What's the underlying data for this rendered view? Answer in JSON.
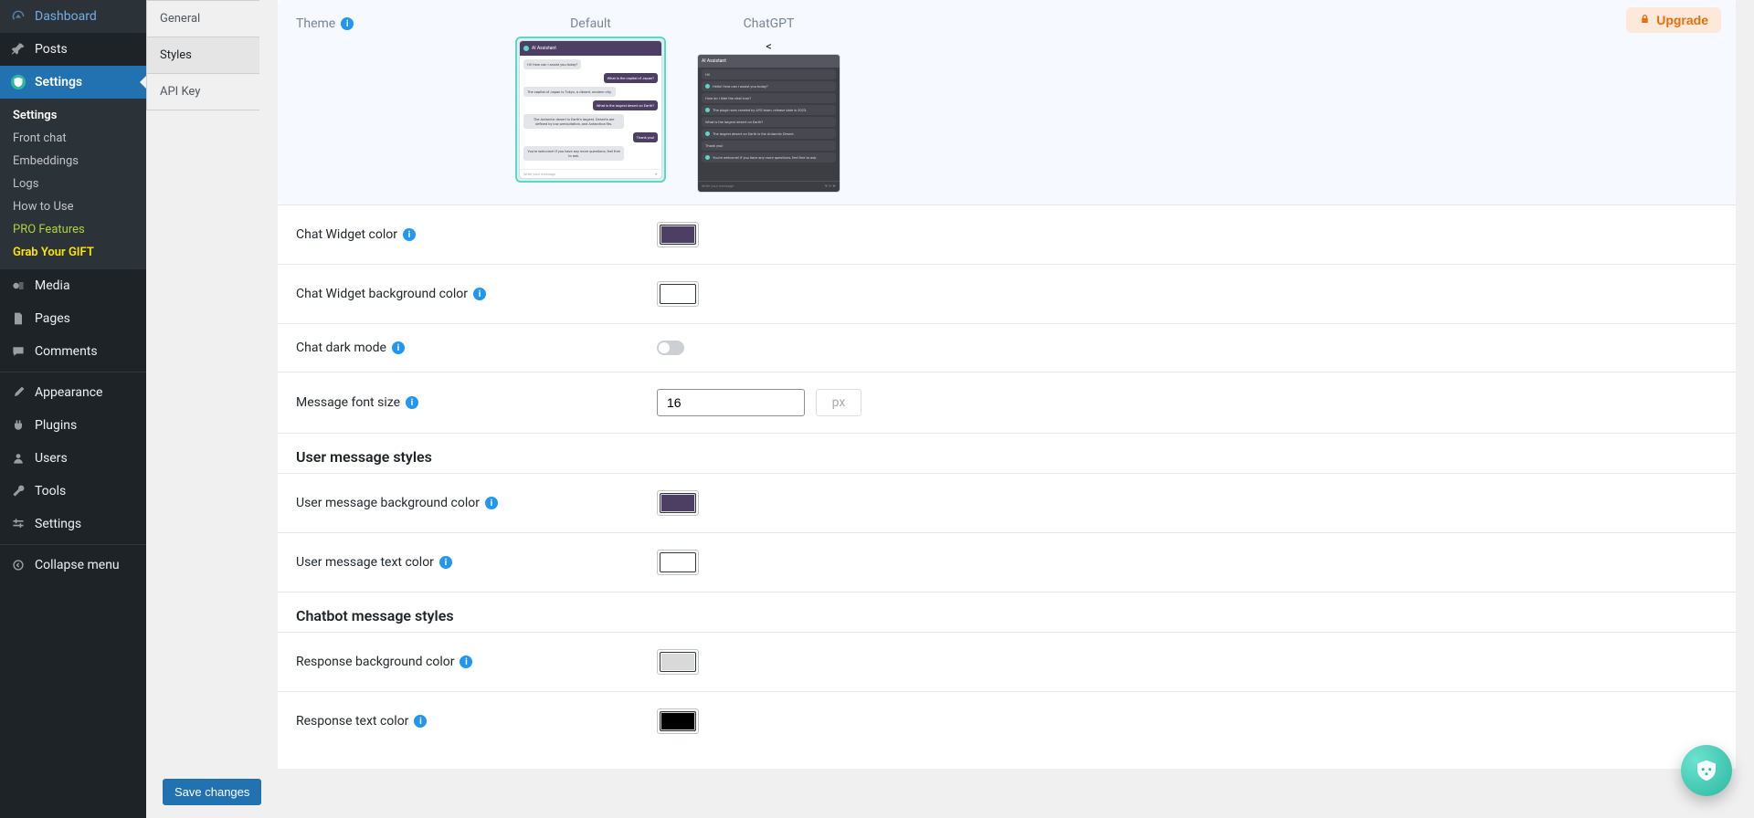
{
  "sidebar": {
    "items": [
      {
        "label": "Dashboard",
        "icon": "dash"
      },
      {
        "label": "Posts",
        "icon": "pin"
      },
      {
        "label": "Settings",
        "icon": "ai",
        "active": true
      },
      {
        "label": "Media",
        "icon": "media"
      },
      {
        "label": "Pages",
        "icon": "page"
      },
      {
        "label": "Comments",
        "icon": "comment"
      },
      {
        "label": "Appearance",
        "icon": "brush"
      },
      {
        "label": "Plugins",
        "icon": "plug"
      },
      {
        "label": "Users",
        "icon": "user"
      },
      {
        "label": "Tools",
        "icon": "wrench"
      },
      {
        "label": "Settings",
        "icon": "sliders"
      },
      {
        "label": "Collapse menu",
        "icon": "collapse"
      }
    ],
    "submenu": [
      {
        "label": "Settings",
        "current": true
      },
      {
        "label": "Front chat"
      },
      {
        "label": "Embeddings"
      },
      {
        "label": "Logs"
      },
      {
        "label": "How to Use"
      },
      {
        "label": "PRO Features",
        "pro": true
      },
      {
        "label": "Grab Your GIFT",
        "gift": true
      }
    ]
  },
  "tabs": [
    "General",
    "Styles",
    "API Key"
  ],
  "tabs_active_index": 1,
  "upgrade_label": "Upgrade",
  "theme": {
    "label": "Theme",
    "options": [
      {
        "name": "Default",
        "selected": true
      },
      {
        "name": "ChatGPT",
        "selected": false
      }
    ],
    "preview": {
      "assistant_title": "AI Assistant",
      "msgs_default": [
        {
          "side": "l",
          "text": "Hi! How can I assist you today?"
        },
        {
          "side": "r",
          "text": "What is the capital of Japan?"
        },
        {
          "side": "l",
          "text": "The capital of Japan is Tokyo, a vibrant, modern city."
        },
        {
          "side": "r",
          "text": "What is the largest desert on Earth?"
        },
        {
          "side": "l",
          "text": "The Antarctic desert is Earth's largest. Deserts are defined by low precipitation, and Antarctica fits."
        },
        {
          "side": "r",
          "text": "Thank you!"
        },
        {
          "side": "l",
          "text": "You're welcome! If you have any more questions, feel free to ask."
        }
      ],
      "rows_gpt": [
        {
          "dot": false,
          "text": "Hi!"
        },
        {
          "dot": true,
          "text": "Hello! How can I assist you today?"
        },
        {
          "dot": false,
          "text": "How do I hide the chat icon?"
        },
        {
          "dot": true,
          "text": "The plugin was created by AYS team, release date is 2023."
        },
        {
          "dot": false,
          "text": "What is the largest desert on Earth?"
        },
        {
          "dot": true,
          "text": "The largest desert on Earth is the Antarctic Desert."
        },
        {
          "dot": false,
          "text": "Thank you!"
        },
        {
          "dot": true,
          "text": "You're welcome! If you have any more questions, feel free to ask."
        }
      ],
      "typing_placeholder": "Write your message"
    }
  },
  "fields": {
    "chat_widget_color": {
      "label": "Chat Widget color",
      "value": "#4d3f63"
    },
    "chat_widget_bg": {
      "label": "Chat Widget background color",
      "value": "#ffffff"
    },
    "chat_dark_mode": {
      "label": "Chat dark mode",
      "value": false
    },
    "message_font_size": {
      "label": "Message font size",
      "value": "16",
      "unit": "px"
    }
  },
  "sections": {
    "user_heading": "User message styles",
    "user_bg": {
      "label": "User message background color",
      "value": "#4d3f63"
    },
    "user_text": {
      "label": "User message text color",
      "value": "#ffffff"
    },
    "bot_heading": "Chatbot message styles",
    "resp_bg": {
      "label": "Response background color",
      "value": "#d9d9d9"
    },
    "resp_text": {
      "label": "Response text color",
      "value": "#000000"
    }
  },
  "save_button": "Save changes"
}
